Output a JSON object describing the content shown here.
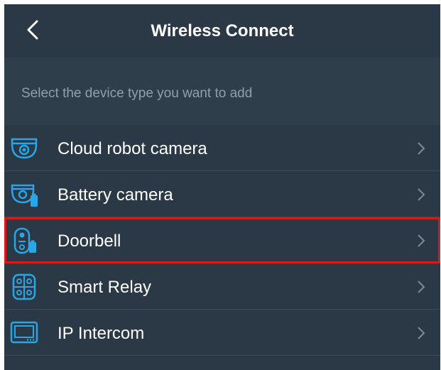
{
  "header": {
    "title": "Wireless Connect",
    "back_icon": "chevron-left-icon"
  },
  "hint": "Select the device type you want to add",
  "devices": [
    {
      "label": "Cloud robot camera",
      "icon": "dome-camera-icon"
    },
    {
      "label": "Battery camera",
      "icon": "battery-camera-icon"
    },
    {
      "label": "Doorbell",
      "icon": "doorbell-icon",
      "highlighted": true
    },
    {
      "label": "Smart Relay",
      "icon": "smart-relay-icon"
    },
    {
      "label": "IP Intercom",
      "icon": "intercom-icon"
    }
  ],
  "colors": {
    "background": "#2b3946",
    "accent_icon": "#29a6e6",
    "highlight_border": "#d81a1a",
    "hint_text": "#8fa0ad"
  }
}
